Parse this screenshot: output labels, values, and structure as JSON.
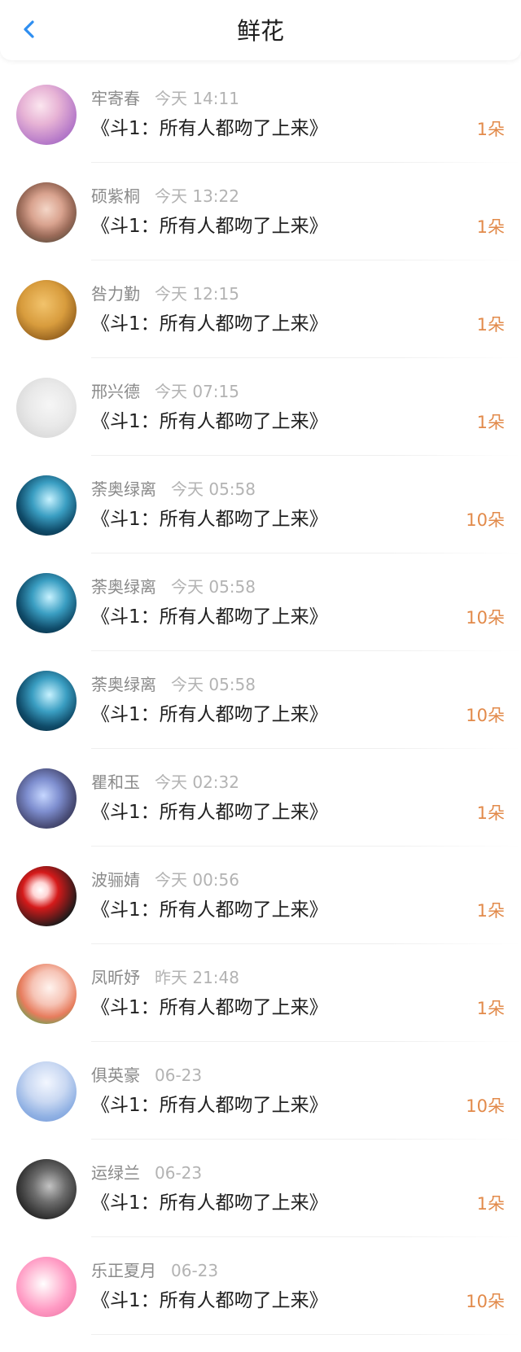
{
  "header": {
    "title": "鲜花",
    "back_icon": "chevron-left-icon",
    "accent": "#2e8ef0"
  },
  "colors": {
    "amount": "#e28a4a",
    "sender": "#8a8a8a",
    "time": "#b3b3b3",
    "book": "#1f1f1f"
  },
  "items": [
    {
      "sender": "牢寄春",
      "time": "今天 14:11",
      "book": "《斗1：所有人都吻了上来》",
      "amount": "1朵"
    },
    {
      "sender": "硕紫桐",
      "time": "今天 13:22",
      "book": "《斗1：所有人都吻了上来》",
      "amount": "1朵"
    },
    {
      "sender": "咎力勤",
      "time": "今天 12:15",
      "book": "《斗1：所有人都吻了上来》",
      "amount": "1朵"
    },
    {
      "sender": "邢兴德",
      "time": "今天 07:15",
      "book": "《斗1：所有人都吻了上来》",
      "amount": "1朵"
    },
    {
      "sender": "荼奥绿离",
      "time": "今天 05:58",
      "book": "《斗1：所有人都吻了上来》",
      "amount": "10朵"
    },
    {
      "sender": "荼奥绿离",
      "time": "今天 05:58",
      "book": "《斗1：所有人都吻了上来》",
      "amount": "10朵"
    },
    {
      "sender": "荼奥绿离",
      "time": "今天 05:58",
      "book": "《斗1：所有人都吻了上来》",
      "amount": "10朵"
    },
    {
      "sender": "瞿和玉",
      "time": "今天 02:32",
      "book": "《斗1：所有人都吻了上来》",
      "amount": "1朵"
    },
    {
      "sender": "波骊婧",
      "time": "今天 00:56",
      "book": "《斗1：所有人都吻了上来》",
      "amount": "1朵"
    },
    {
      "sender": "凤昕妤",
      "time": "昨天 21:48",
      "book": "《斗1：所有人都吻了上来》",
      "amount": "1朵"
    },
    {
      "sender": "俱英豪",
      "time": "06-23",
      "book": "《斗1：所有人都吻了上来》",
      "amount": "10朵"
    },
    {
      "sender": "运绿兰",
      "time": "06-23",
      "book": "《斗1：所有人都吻了上来》",
      "amount": "1朵"
    },
    {
      "sender": "乐正夏月",
      "time": "06-23",
      "book": "《斗1：所有人都吻了上来》",
      "amount": "10朵"
    }
  ]
}
